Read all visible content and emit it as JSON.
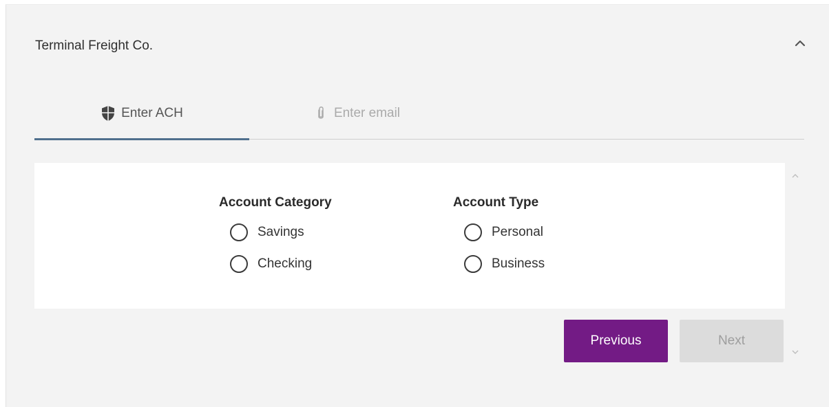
{
  "header": {
    "company_name": "Terminal Freight Co.",
    "collapse_icon": "chevron-up-icon"
  },
  "tabs": [
    {
      "label": "Enter ACH",
      "icon": "shield-icon",
      "active": true
    },
    {
      "label": "Enter email",
      "icon": "paperclip-icon",
      "active": false
    }
  ],
  "form": {
    "account_category": {
      "title": "Account Category",
      "options": [
        "Savings",
        "Checking"
      ],
      "selected": null
    },
    "account_type": {
      "title": "Account Type",
      "options": [
        "Personal",
        "Business"
      ],
      "selected": null
    }
  },
  "buttons": {
    "previous_label": "Previous",
    "next_label": "Next",
    "next_enabled": false
  },
  "colors": {
    "accent": "#731b85",
    "active_tab_underline": "#4f6f8d",
    "panel_background": "#f3f3f3"
  }
}
